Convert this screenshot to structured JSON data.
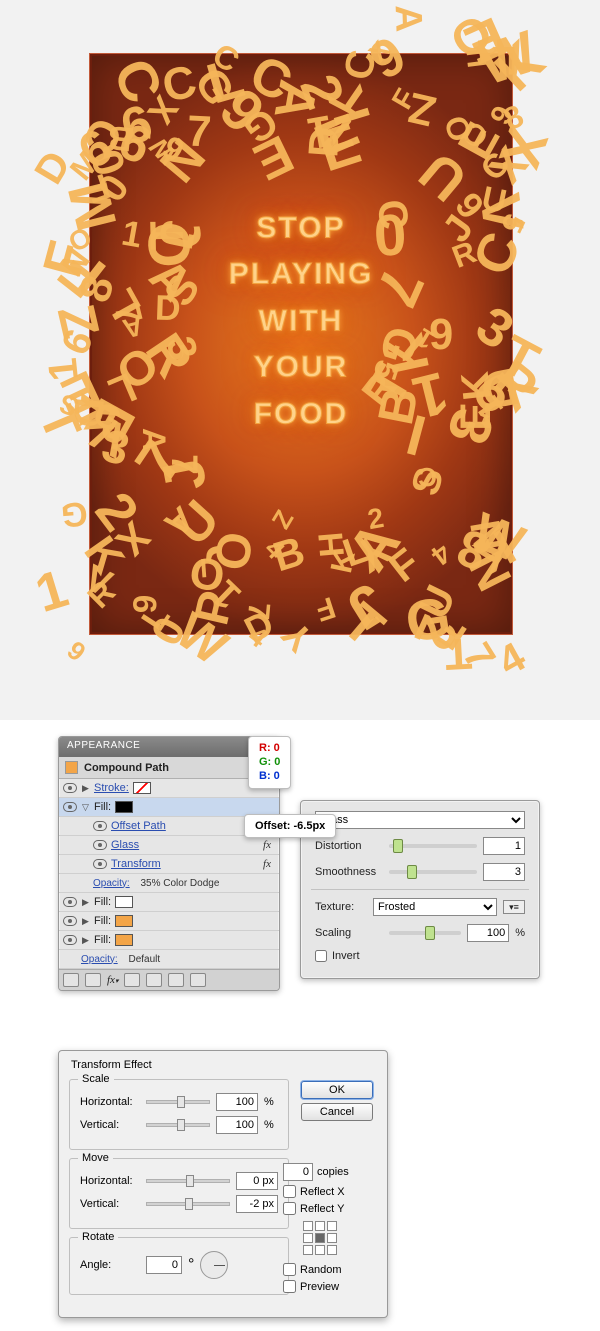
{
  "artwork": {
    "lines": [
      "STOP",
      "PLAYING",
      "WITH",
      "YOUR",
      "FOOD"
    ],
    "scatter_glyphs": "ABCDEFGHIJKLMNOPQRSTUVWXYZ0123456789"
  },
  "rgb_popout": {
    "r": "R: 0",
    "g": "G: 0",
    "b": "B: 0"
  },
  "offset_popout": "Offset: -6.5px",
  "appearance": {
    "title": "APPEARANCE",
    "object": "Compound Path",
    "rows": {
      "stroke_label": "Stroke:",
      "fill_label": "Fill:",
      "offset_path": "Offset Path",
      "glass": "Glass",
      "transform": "Transform",
      "opacity_label": "Opacity:",
      "opacity_fill_value": "35% Color Dodge",
      "opacity_default": "Default"
    }
  },
  "glass": {
    "preset": "Glass",
    "distortion_label": "Distortion",
    "distortion_value": "1",
    "smoothness_label": "Smoothness",
    "smoothness_value": "3",
    "texture_label": "Texture:",
    "texture_value": "Frosted",
    "scaling_label": "Scaling",
    "scaling_value": "100",
    "scaling_unit": "%",
    "invert_label": "Invert"
  },
  "transform": {
    "title": "Transform Effect",
    "scale": {
      "legend": "Scale",
      "h_label": "Horizontal:",
      "h_value": "100",
      "v_label": "Vertical:",
      "v_value": "100",
      "unit": "%"
    },
    "move": {
      "legend": "Move",
      "h_label": "Horizontal:",
      "h_value": "0 px",
      "v_label": "Vertical:",
      "v_value": "-2 px"
    },
    "rotate": {
      "legend": "Rotate",
      "angle_label": "Angle:",
      "angle_value": "0",
      "angle_unit": "°"
    },
    "ok": "OK",
    "cancel": "Cancel",
    "copies_value": "0",
    "copies_label": "copies",
    "reflect_x": "Reflect X",
    "reflect_y": "Reflect Y",
    "random": "Random",
    "preview": "Preview"
  }
}
